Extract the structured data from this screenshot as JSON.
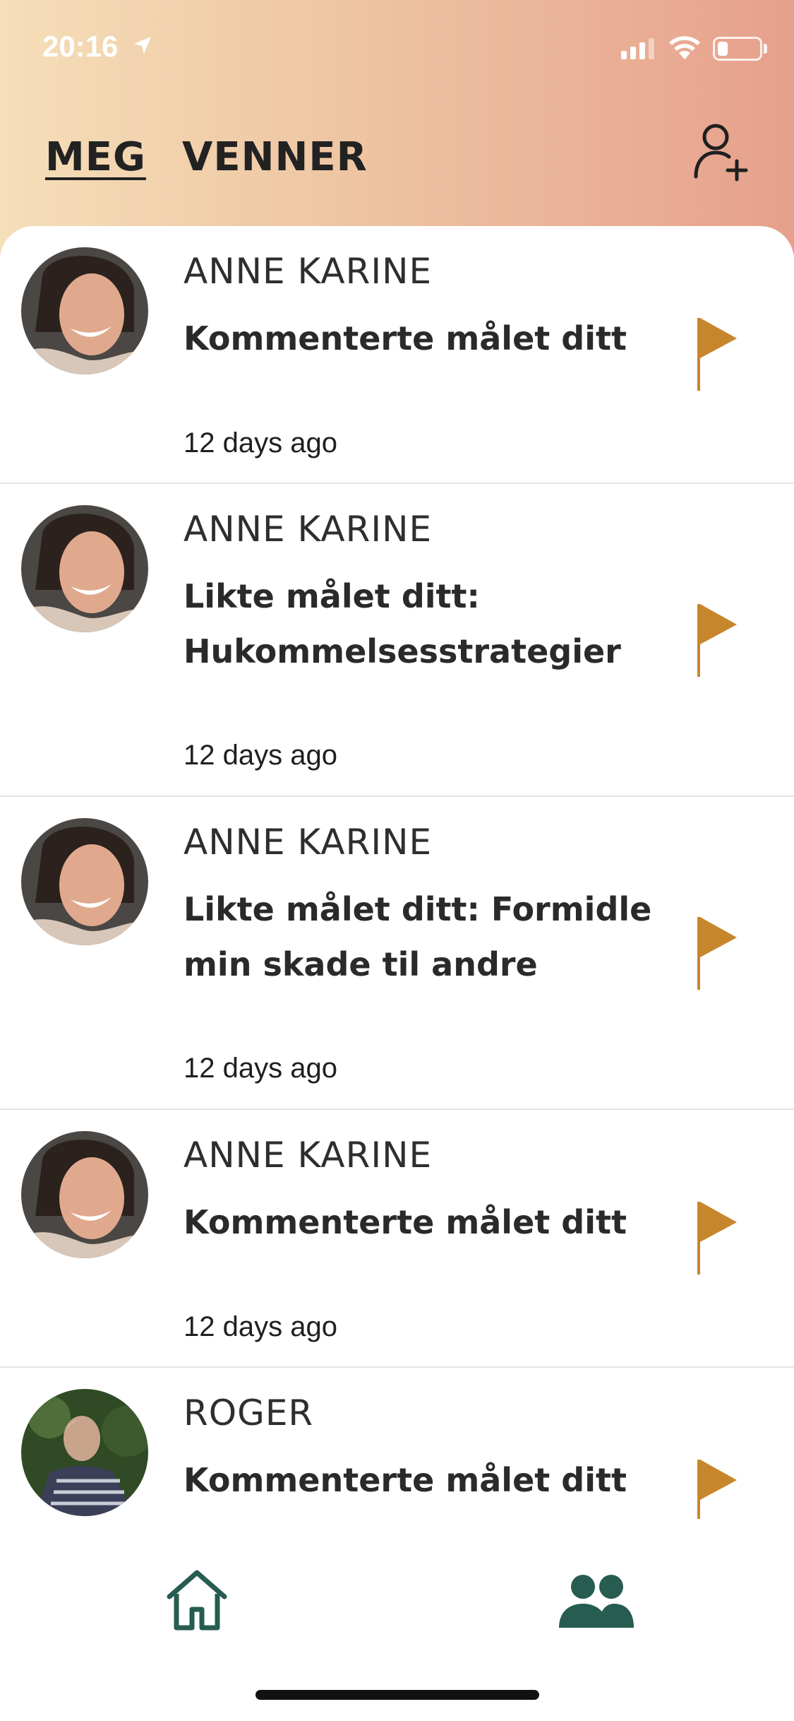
{
  "status_bar": {
    "time": "20:16",
    "battery_level": 0.25
  },
  "header": {
    "tabs": [
      {
        "label": "MEG",
        "active": true
      },
      {
        "label": "VENNER",
        "active": false
      }
    ],
    "add_friend_icon": "person-plus-icon"
  },
  "feed": [
    {
      "name": "ANNE KARINE",
      "action": "Kommenterte målet ditt",
      "time": "12 days ago",
      "avatar": "anne-karine"
    },
    {
      "name": "ANNE KARINE",
      "action": "Likte målet ditt: Hukommelsesstrategier",
      "time": "12 days ago",
      "avatar": "anne-karine"
    },
    {
      "name": "ANNE KARINE",
      "action": "Likte målet ditt: Formidle min skade til andre",
      "time": "12 days ago",
      "avatar": "anne-karine"
    },
    {
      "name": "ANNE KARINE",
      "action": "Kommenterte målet ditt",
      "time": "12 days ago",
      "avatar": "anne-karine"
    },
    {
      "name": "ROGER",
      "action": "Kommenterte målet ditt",
      "time": "",
      "avatar": "roger"
    }
  ],
  "bottom_nav": {
    "items": [
      "home-icon",
      "friends-icon"
    ]
  },
  "colors": {
    "flag": "#c8862c",
    "nav_icon": "#275c50",
    "header_gradient_start": "#f5dfb8",
    "header_gradient_end": "#e6a08c"
  }
}
